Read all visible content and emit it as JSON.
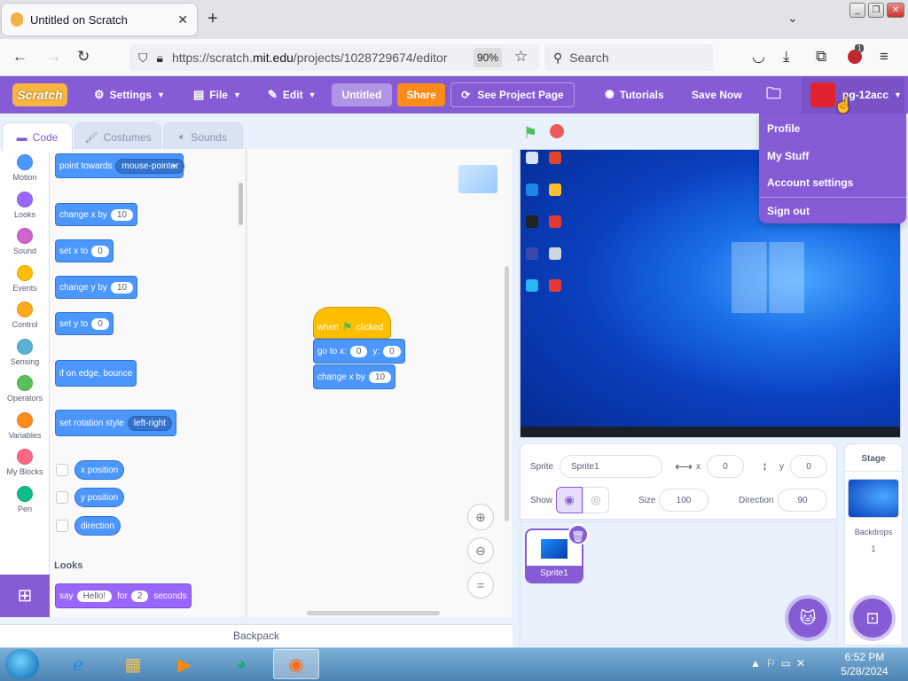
{
  "browser": {
    "tab_title": "Untitled on Scratch",
    "url_host": "https://scratch.",
    "url_domain": "mit.edu",
    "url_path": "/projects/1028729674/editor",
    "zoom": "90%",
    "search_placeholder": "Search",
    "extension_badge": "1"
  },
  "menubar": {
    "logo": "Scratch",
    "settings": "Settings",
    "file": "File",
    "edit": "Edit",
    "project_title": "Untitled",
    "share": "Share",
    "see_project_page": "See Project Page",
    "tutorials": "Tutorials",
    "save_now": "Save Now",
    "username": "pg-12acc"
  },
  "account_menu": {
    "items": [
      "Profile",
      "My Stuff",
      "Account settings",
      "Sign out"
    ]
  },
  "editor_tabs": [
    "Code",
    "Costumes",
    "Sounds"
  ],
  "categories": [
    {
      "label": "Motion",
      "color": "#4c97ff"
    },
    {
      "label": "Looks",
      "color": "#9966ff"
    },
    {
      "label": "Sound",
      "color": "#cf63cf"
    },
    {
      "label": "Events",
      "color": "#ffbf00"
    },
    {
      "label": "Control",
      "color": "#ffab19"
    },
    {
      "label": "Sensing",
      "color": "#5cb1d6"
    },
    {
      "label": "Operators",
      "color": "#59c059"
    },
    {
      "label": "Variables",
      "color": "#ff8c1a"
    },
    {
      "label": "My Blocks",
      "color": "#ff6680"
    },
    {
      "label": "Pen",
      "color": "#0fbd8c"
    }
  ],
  "palette": {
    "point_towards": "point towards",
    "point_towards_value": "mouse-pointer",
    "change_x": "change x by",
    "change_x_value": "10",
    "set_x": "set x to",
    "set_x_value": "0",
    "change_y": "change y by",
    "change_y_value": "10",
    "set_y": "set y to",
    "set_y_value": "0",
    "if_on_edge": "if on edge, bounce",
    "rotation_style": "set rotation style",
    "rotation_style_value": "left-right",
    "x_position": "x position",
    "y_position": "y position",
    "direction": "direction",
    "looks_heading": "Looks",
    "say": "say",
    "say_value": "Hello!",
    "say_for": "for",
    "say_secs_value": "2",
    "say_seconds": "seconds"
  },
  "script": {
    "when": "when",
    "clicked": "clicked",
    "goto": "go to x:",
    "goto_x": "0",
    "goto_y_label": "y:",
    "goto_y": "0",
    "change_x": "change x by",
    "change_x_value": "10"
  },
  "backpack": "Backpack",
  "sprite_info": {
    "sprite_label": "Sprite",
    "sprite_name": "Sprite1",
    "x_label": "x",
    "x_value": "0",
    "y_label": "y",
    "y_value": "0",
    "show_label": "Show",
    "size_label": "Size",
    "size_value": "100",
    "direction_label": "Direction",
    "direction_value": "90"
  },
  "sprites": [
    "Sprite1"
  ],
  "stage_pane": {
    "title": "Stage",
    "backdrops_label": "Backdrops",
    "backdrops_count": "1"
  },
  "taskbar": {
    "time": "6:52 PM",
    "date": "5/28/2024"
  }
}
